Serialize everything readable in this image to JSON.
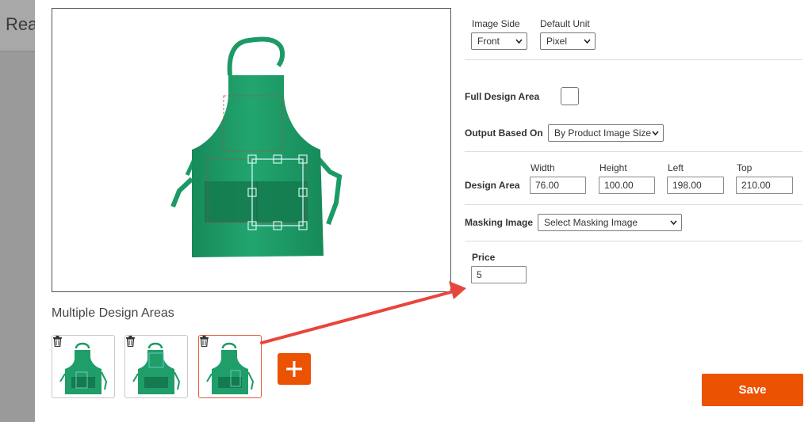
{
  "background": {
    "title_fragment": "Rea"
  },
  "design_area_label": "Multiple Design Areas",
  "add_button": "+",
  "form": {
    "image_side": {
      "label": "Image Side",
      "value": "Front"
    },
    "default_unit": {
      "label": "Default Unit",
      "value": "Pixel"
    },
    "full_design_area": {
      "label": "Full Design Area",
      "checked": false
    },
    "output_based_on": {
      "label": "Output Based On",
      "value": "By Product Image Size"
    },
    "design_area": {
      "label": "Design Area",
      "width": {
        "label": "Width",
        "value": "76.00"
      },
      "height": {
        "label": "Height",
        "value": "100.00"
      },
      "left": {
        "label": "Left",
        "value": "198.00"
      },
      "top": {
        "label": "Top",
        "value": "210.00"
      }
    },
    "masking_image": {
      "label": "Masking Image",
      "value": "Select Masking Image"
    },
    "price": {
      "label": "Price",
      "value": "5"
    }
  },
  "save_button": "Save",
  "colors": {
    "accent": "#eb5202",
    "apron": "#1f9e6a",
    "selection": "#6ec6c0",
    "arrow": "#e8453c"
  },
  "icons": {
    "trash": "trash-icon",
    "chevron": "chevron-down-icon",
    "plus": "plus-icon"
  }
}
